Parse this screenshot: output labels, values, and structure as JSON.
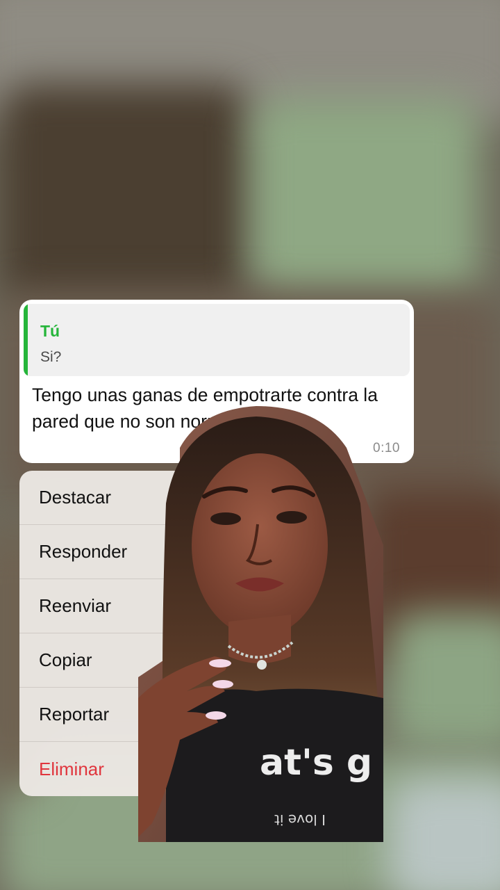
{
  "message": {
    "quote": {
      "author": "Tú",
      "text": "Si?"
    },
    "text": "Tengo unas ganas de empotrarte contra la pared que no son normales",
    "time": "0:10"
  },
  "menu": {
    "items": [
      {
        "label": "Destacar"
      },
      {
        "label": "Responder"
      },
      {
        "label": "Reenviar"
      },
      {
        "label": "Copiar"
      },
      {
        "label": "Reportar"
      },
      {
        "label": "Eliminar"
      }
    ]
  },
  "photo": {
    "shirt_text": "at's g",
    "shirt_subtext": "I love it"
  },
  "colors": {
    "accent_green": "#25b53a",
    "danger_red": "#e0353d"
  }
}
